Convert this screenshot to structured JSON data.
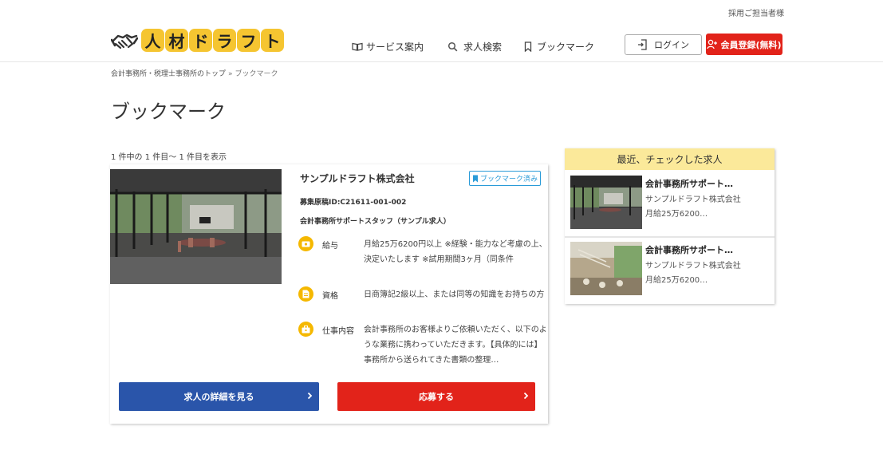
{
  "header": {
    "recruiter_link": "採用ご担当者様",
    "logo_chars": [
      "人",
      "材",
      "ド",
      "ラ",
      "フ",
      "ト"
    ],
    "nav": [
      {
        "label": "サービス案内",
        "icon": "book-icon"
      },
      {
        "label": "求人検索",
        "icon": "search-icon"
      },
      {
        "label": "ブックマーク",
        "icon": "bookmark-icon"
      }
    ],
    "login_label": "ログイン",
    "register_label": "会員登録(無料)"
  },
  "breadcrumb": {
    "home": "会計事務所・税理士事務所のトップ",
    "separator": "»",
    "current": "ブックマーク"
  },
  "page_title": "ブックマーク",
  "result_count": "1 件中の 1 件目～ 1 件目を表示",
  "job": {
    "company": "サンプルドラフト株式会社",
    "bookmark_badge": "ブックマーク済み",
    "manuscript_id": "募集原稿ID:C21611-001-002",
    "title": "会計事務所サポートスタッフ（サンプル求人）",
    "rows": [
      {
        "label": "給与",
        "icon": "money-icon",
        "text": "月給25万6200円以上 ※経験・能力など考慮の上、決定いたします ※試用期間3ヶ月（同条件"
      },
      {
        "label": "資格",
        "icon": "document-icon",
        "text": "日商簿記2級以上、または同等の知識をお持ちの方"
      },
      {
        "label": "仕事内容",
        "icon": "briefcase-icon",
        "text": "会計事務所のお客様よりご依頼いただく、以下のような業務に携わっていただきます。【具体的には】 事務所から送られてきた書類の整理…"
      }
    ],
    "detail_button": "求人の詳細を見る",
    "apply_button": "応募する"
  },
  "recent": {
    "heading": "最近、チェックした求人",
    "items": [
      {
        "title": "会計事務所サポート…",
        "company": "サンプルドラフト株式会社",
        "salary": "月給25万6200…"
      },
      {
        "title": "会計事務所サポート…",
        "company": "サンプルドラフト株式会社",
        "salary": "月給25万6200…"
      }
    ]
  },
  "colors": {
    "accent_yellow": "#f5c531",
    "register_red": "#e2231a",
    "detail_blue": "#2a55aa",
    "badge_blue": "#2a9bd8",
    "recent_header": "#fbe99a"
  }
}
